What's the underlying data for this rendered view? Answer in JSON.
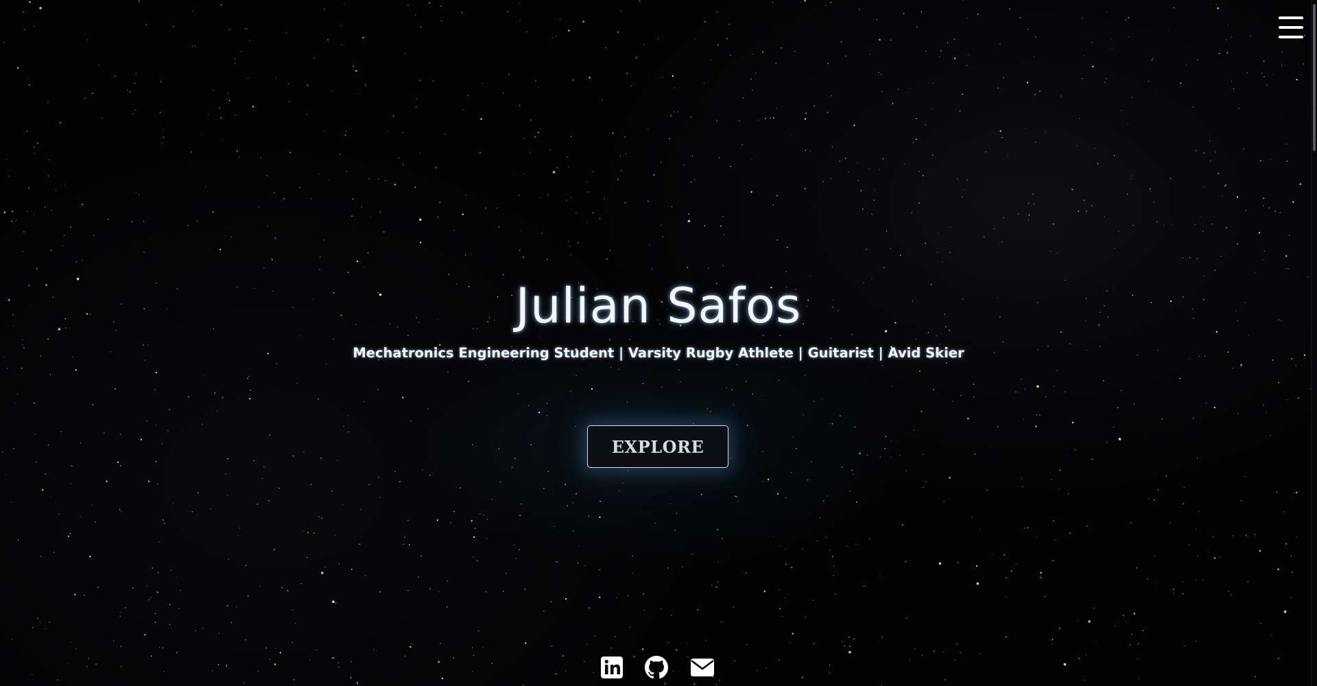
{
  "hero": {
    "title": "Julian Safos",
    "subtitle": "Mechatronics Engineering Student | Varsity Rugby Athlete | Guitarist | Avid Skier",
    "cta_label": "EXPLORE"
  },
  "nav": {
    "menu_icon": "hamburger-menu-icon"
  },
  "socials": [
    {
      "icon": "linkedin-icon"
    },
    {
      "icon": "github-icon"
    },
    {
      "icon": "email-icon"
    }
  ],
  "colors": {
    "background": "#030304",
    "text": "#f3f6fb",
    "glow": "#78aae6",
    "button_bg": "#0e0e16",
    "button_border": "#d9dce4"
  }
}
